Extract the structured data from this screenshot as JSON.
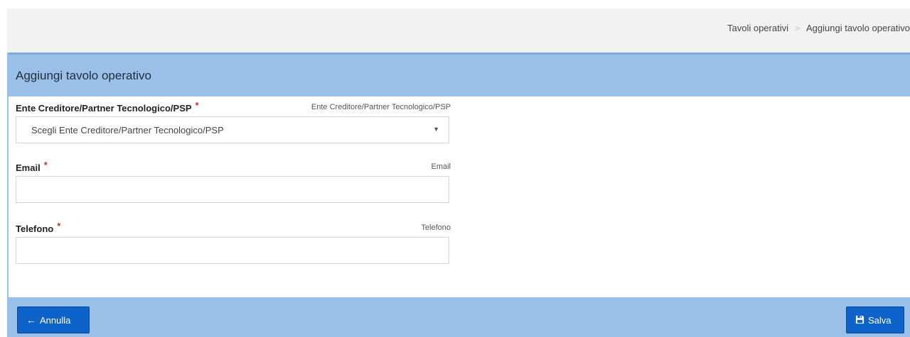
{
  "breadcrumb": {
    "items": [
      "Tavoli operativi",
      "Aggiungi tavolo operativo"
    ],
    "separator": ">"
  },
  "panel": {
    "title": "Aggiungi tavolo operativo"
  },
  "form": {
    "ente": {
      "label": "Ente Creditore/Partner Tecnologico/PSP",
      "required": "*",
      "hint": "Ente Creditore/Partner Tecnologico/PSP",
      "selected": "Scegli Ente Creditore/Partner Tecnologico/PSP"
    },
    "email": {
      "label": "Email",
      "required": "*",
      "hint": "Email",
      "value": ""
    },
    "telefono": {
      "label": "Telefono",
      "required": "*",
      "hint": "Telefono",
      "value": ""
    }
  },
  "footer": {
    "cancel_label": "Annulla",
    "save_label": "Salva"
  },
  "icons": {
    "cancel": "arrow-left-icon",
    "save": "floppy-disk-icon",
    "dropdown": "caret-down-icon"
  },
  "colors": {
    "panel_header": "#9ac0ea",
    "button": "#0d63c9",
    "required": "#c0392b"
  }
}
